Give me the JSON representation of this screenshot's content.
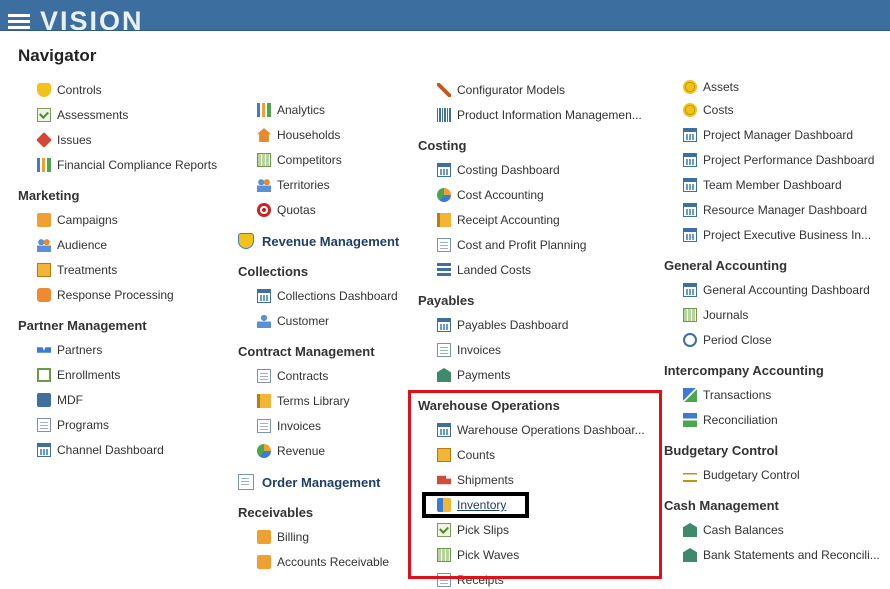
{
  "app": {
    "logo_text": "VISION"
  },
  "navigator": {
    "title": "Navigator",
    "col1": {
      "top_items": [
        {
          "label": "Controls",
          "icon": "shield-icon"
        },
        {
          "label": "Assessments",
          "icon": "checklist-icon"
        },
        {
          "label": "Issues",
          "icon": "tag-icon"
        },
        {
          "label": "Financial Compliance Reports",
          "icon": "bar-chart-icon"
        }
      ],
      "marketing": {
        "heading": "Marketing",
        "items": [
          {
            "label": "Campaigns",
            "icon": "campaign-icon"
          },
          {
            "label": "Audience",
            "icon": "audience-icon"
          },
          {
            "label": "Treatments",
            "icon": "clipboard-icon"
          },
          {
            "label": "Response Processing",
            "icon": "speech-bubble-icon"
          }
        ]
      },
      "partner": {
        "heading": "Partner Management",
        "items": [
          {
            "label": "Partners",
            "icon": "handshake-icon"
          },
          {
            "label": "Enrollments",
            "icon": "enrollment-icon"
          },
          {
            "label": "MDF",
            "icon": "mdf-icon"
          },
          {
            "label": "Programs",
            "icon": "document-icon"
          },
          {
            "label": "Channel Dashboard",
            "icon": "dashboard-icon"
          }
        ]
      }
    },
    "col2": {
      "top_items": [
        {
          "label": "Analytics",
          "icon": "analytics-icon"
        },
        {
          "label": "Households",
          "icon": "house-icon"
        },
        {
          "label": "Competitors",
          "icon": "grid-icon"
        },
        {
          "label": "Territories",
          "icon": "territories-icon"
        },
        {
          "label": "Quotas",
          "icon": "target-icon"
        }
      ],
      "revenue_management": "Revenue Management",
      "collections": {
        "heading": "Collections",
        "items": [
          {
            "label": "Collections Dashboard",
            "icon": "dashboard-icon"
          },
          {
            "label": "Customer",
            "icon": "user-icon"
          }
        ]
      },
      "contract": {
        "heading": "Contract Management",
        "items": [
          {
            "label": "Contracts",
            "icon": "document-icon"
          },
          {
            "label": "Terms Library",
            "icon": "book-icon"
          },
          {
            "label": "Invoices",
            "icon": "document-icon"
          },
          {
            "label": "Revenue",
            "icon": "pie-icon"
          }
        ]
      },
      "order_management": "Order Management",
      "receivables": {
        "heading": "Receivables",
        "items": [
          {
            "label": "Billing",
            "icon": "envelope-icon"
          },
          {
            "label": "Accounts Receivable",
            "icon": "envelope-icon"
          }
        ]
      }
    },
    "col3": {
      "top_items": [
        {
          "label": "Configurator Models",
          "icon": "wrench-icon"
        },
        {
          "label": "Product Information Managemen...",
          "icon": "barcode-icon"
        }
      ],
      "costing": {
        "heading": "Costing",
        "items": [
          {
            "label": "Costing Dashboard",
            "icon": "dashboard-icon"
          },
          {
            "label": "Cost Accounting",
            "icon": "cost-accounting-icon"
          },
          {
            "label": "Receipt Accounting",
            "icon": "receipt-icon"
          },
          {
            "label": "Cost and Profit Planning",
            "icon": "planning-icon"
          },
          {
            "label": "Landed Costs",
            "icon": "landed-costs-icon"
          }
        ]
      },
      "payables": {
        "heading": "Payables",
        "items": [
          {
            "label": "Payables Dashboard",
            "icon": "dashboard-icon"
          },
          {
            "label": "Invoices",
            "icon": "document-icon"
          },
          {
            "label": "Payments",
            "icon": "bank-icon"
          }
        ]
      },
      "warehouse": {
        "heading": "Warehouse Operations",
        "items": [
          {
            "label": "Warehouse Operations Dashboar...",
            "icon": "dashboard-icon"
          },
          {
            "label": "Counts",
            "icon": "clipboard-icon"
          },
          {
            "label": "Shipments",
            "icon": "truck-icon"
          },
          {
            "label": "Inventory",
            "icon": "inventory-icon"
          },
          {
            "label": "Pick Slips",
            "icon": "checklist-icon"
          },
          {
            "label": "Pick Waves",
            "icon": "pick-waves-icon"
          }
        ]
      },
      "partial_item": "Receipts"
    },
    "col4": {
      "top_items": [
        {
          "label": "Assets",
          "icon": "asset-icon"
        },
        {
          "label": "Costs",
          "icon": "coins-icon"
        },
        {
          "label": "Project Manager Dashboard",
          "icon": "dashboard-icon"
        },
        {
          "label": "Project Performance Dashboard",
          "icon": "dashboard-icon"
        },
        {
          "label": "Team Member Dashboard",
          "icon": "dashboard-icon"
        },
        {
          "label": "Resource Manager Dashboard",
          "icon": "dashboard-icon"
        },
        {
          "label": "Project Executive Business In...",
          "icon": "dashboard-icon"
        }
      ],
      "general_accounting": {
        "heading": "General Accounting",
        "items": [
          {
            "label": "General Accounting Dashboard",
            "icon": "dashboard-icon"
          },
          {
            "label": "Journals",
            "icon": "journal-icon"
          },
          {
            "label": "Period Close",
            "icon": "period-close-icon"
          }
        ]
      },
      "intercompany": {
        "heading": "Intercompany Accounting",
        "items": [
          {
            "label": "Transactions",
            "icon": "transactions-icon"
          },
          {
            "label": "Reconciliation",
            "icon": "reconciliation-icon"
          }
        ]
      },
      "budgetary": {
        "heading": "Budgetary Control",
        "items": [
          {
            "label": "Budgetary Control",
            "icon": "scale-icon"
          }
        ]
      },
      "cash": {
        "heading": "Cash Management",
        "items": [
          {
            "label": "Cash Balances",
            "icon": "bank-icon"
          },
          {
            "label": "Bank Statements and Reconcili...",
            "icon": "bank-icon"
          }
        ]
      }
    }
  },
  "highlight_colors": {
    "red_box": "#e0101b",
    "black_box": "#000000"
  }
}
